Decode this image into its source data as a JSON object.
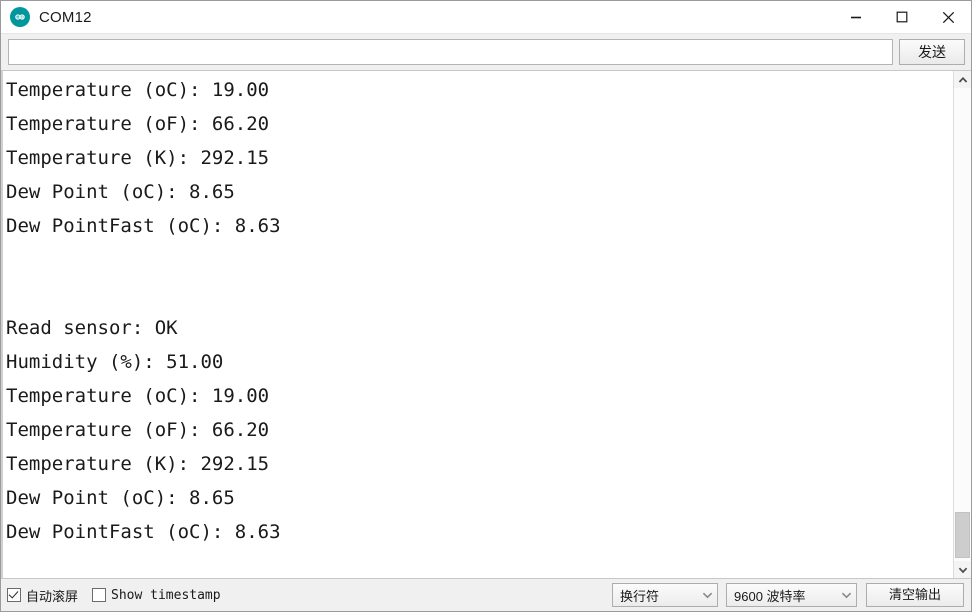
{
  "window": {
    "title": "COM12",
    "icon": "arduino-logo-icon",
    "accent_color": "#00979c",
    "controls": {
      "minimize": "minimize-icon",
      "maximize": "maximize-icon",
      "close": "close-icon"
    }
  },
  "send_row": {
    "input_value": "",
    "input_placeholder": "",
    "send_label": "发送"
  },
  "console": {
    "lines": [
      "Temperature (oC): 19.00",
      "Temperature (oF): 66.20",
      "Temperature (K): 292.15",
      "Dew Point (oC): 8.65",
      "Dew PointFast (oC): 8.63",
      "",
      "",
      "Read sensor: OK",
      "Humidity (%): 51.00",
      "Temperature (oC): 19.00",
      "Temperature (oF): 66.20",
      "Temperature (K): 292.15",
      "Dew Point (oC): 8.65",
      "Dew PointFast (oC): 8.63"
    ]
  },
  "scrollbar": {
    "up_icon": "chevron-up-icon",
    "down_icon": "chevron-down-icon"
  },
  "status_bar": {
    "autoscroll_label": "自动滚屏",
    "autoscroll_checked": true,
    "timestamp_label": "Show timestamp",
    "timestamp_checked": false,
    "newline_value": "换行符",
    "baud_value": "9600 波特率",
    "clear_label": "清空输出"
  }
}
